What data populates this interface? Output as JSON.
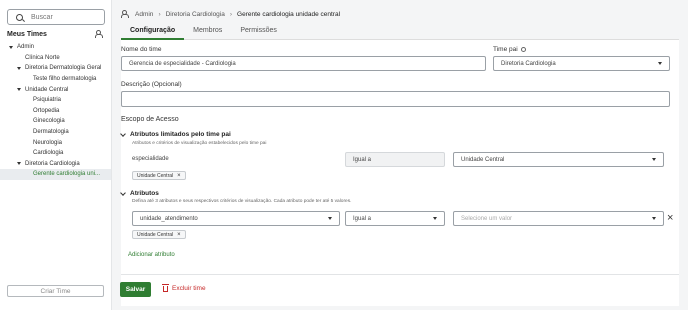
{
  "sidebar": {
    "search_placeholder": "Buscar",
    "teams_title": "Meus Times",
    "tree": [
      {
        "label": "Admin",
        "level": 0,
        "expanded": true
      },
      {
        "label": "Clínica Norte",
        "level": 1
      },
      {
        "label": "Diretoria Dermatologia Geral",
        "level": 1,
        "expanded": true
      },
      {
        "label": "Teste filho dermatologia",
        "level": 2
      },
      {
        "label": "Unidade Central",
        "level": 1,
        "expanded": true
      },
      {
        "label": "Psiquiatria",
        "level": 2
      },
      {
        "label": "Ortopedia",
        "level": 2
      },
      {
        "label": "Ginecologia",
        "level": 2
      },
      {
        "label": "Dermatologia",
        "level": 2
      },
      {
        "label": "Neurologia",
        "level": 2
      },
      {
        "label": "Cardiologia",
        "level": 2
      },
      {
        "label": "Diretoria Cardiologia",
        "level": 1,
        "expanded": true
      },
      {
        "label": "Gerente cardiologia uni...",
        "level": 2,
        "selected": true
      }
    ],
    "create_button": "Criar Time"
  },
  "breadcrumb": {
    "items": [
      "Admin",
      "Diretoria Cardiologia",
      "Gerente cardiologia unidade central"
    ]
  },
  "tabs": [
    "Configuração",
    "Membros",
    "Permissões"
  ],
  "form": {
    "name_label": "Nome do time",
    "name_value": "Gerencia de especialidade - Cardiologia",
    "parent_label": "Time pai",
    "parent_value": "Diretoria Cardiologia",
    "description_label": "Descrição (Opcional)",
    "description_value": "",
    "scope_title": "Escopo de Acesso",
    "limited": {
      "title": "Atributos limitados pelo time pai",
      "description": "Atributos e critérios de visualização estabelecidos pelo time pai",
      "attribute": "especialidade",
      "operator": "Igual a",
      "value": "Unidade Central",
      "chip": "Unidade Central"
    },
    "attributes": {
      "title": "Atributos",
      "description": "Defina até 3 atributos e seus respectivos critérios de visualização. Cada atributo pode ter até 5 valores.",
      "attribute": "unidade_atendimento",
      "operator": "Igual a",
      "value_placeholder": "Selecione um valor",
      "chip": "Unidade Central",
      "add_label": "Adicionar atributo"
    },
    "save_label": "Salvar",
    "delete_label": "Excluir time"
  },
  "colors": {
    "accent": "#2f7d32",
    "danger": "#c62828"
  }
}
